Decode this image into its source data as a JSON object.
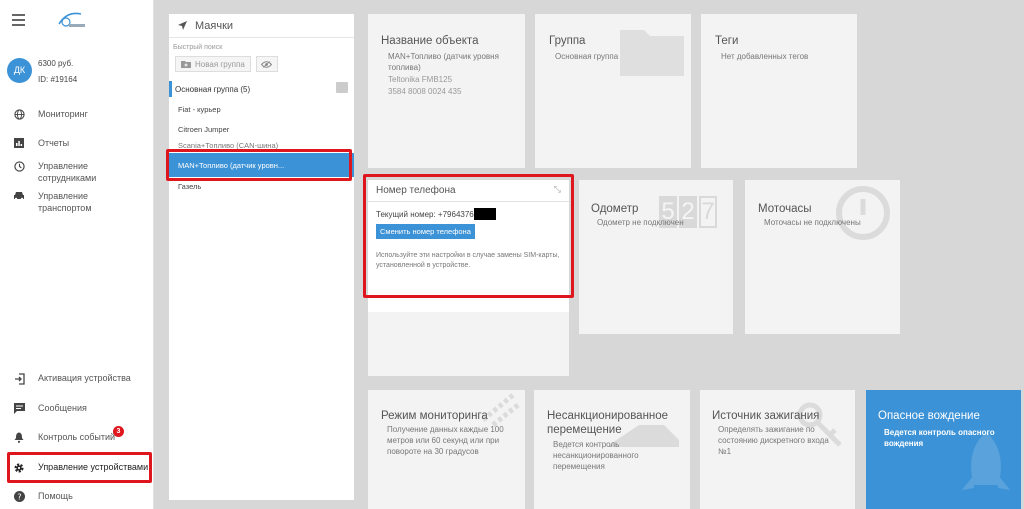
{
  "sidebar": {
    "avatar_initials": "ДК",
    "balance": "6300 руб.",
    "account_id": "ID: #19164",
    "nav_top": [
      {
        "label": "Мониторинг",
        "icon": "globe-icon"
      },
      {
        "label": "Отчеты",
        "icon": "chart-icon"
      },
      {
        "label": "Управление сотрудниками",
        "icon": "clock-icon"
      },
      {
        "label": "Управление транспортом",
        "icon": "car-icon"
      }
    ],
    "nav_bottom": [
      {
        "label": "Активация устройства",
        "icon": "login-icon"
      },
      {
        "label": "Сообщения",
        "icon": "message-icon"
      },
      {
        "label": "Контроль событий",
        "icon": "bell-icon",
        "badge": "3"
      },
      {
        "label": "Управление устройствами",
        "icon": "gear-icon"
      },
      {
        "label": "Помощь",
        "icon": "help-icon"
      }
    ]
  },
  "panel": {
    "title": "Маячки",
    "quick_search": "Быстрый поиск",
    "new_group": "Новая группа",
    "group_label": "Основная группа (5)",
    "trackers": [
      "Fiat - курьер",
      "Citroen Jumper",
      "Scania+Топливо (CAN-шина)",
      "MAN+Топливо (датчик уровн...",
      "Газель"
    ]
  },
  "tiles": {
    "object": {
      "title": "Название объекта",
      "name": "MAN+Топливо (датчик уровня топлива)",
      "model": "Teltonika FMB125",
      "imei": "3584 8008 0024 435"
    },
    "group": {
      "title": "Группа",
      "value": "Основная группа"
    },
    "tags": {
      "title": "Теги",
      "value": "Нет добавленных тегов"
    },
    "phone": {
      "title": "Номер телефона",
      "current_label": "Текущий номер: +7964376",
      "button": "Сменить номер телефона",
      "hint": "Используйте эти настройки в случае замены SIM-карты, установленной в устройстве."
    },
    "odometer": {
      "title": "Одометр",
      "value": "Одометр не подключен",
      "digits": [
        "5",
        "2",
        "7"
      ]
    },
    "hours": {
      "title": "Моточасы",
      "value": "Моточасы не подключены"
    },
    "mode": {
      "title": "Режим мониторинга",
      "value": "Получение данных каждые 100 метров или 60 секунд или при повороте на 30 градусов"
    },
    "unauth": {
      "title": "Несанкционированное перемещение",
      "value": "Ведется контроль несанкционированного перемещения"
    },
    "ignition": {
      "title": "Источник зажигания",
      "value": "Определять зажигание по состоянию дискретного входа №1"
    },
    "danger": {
      "title": "Опасное вождение",
      "value": "Ведется контроль опасного вождения"
    }
  },
  "colors": {
    "accent": "#3c92d6",
    "highlight": "#e0161e",
    "badge": "#e0161e"
  }
}
